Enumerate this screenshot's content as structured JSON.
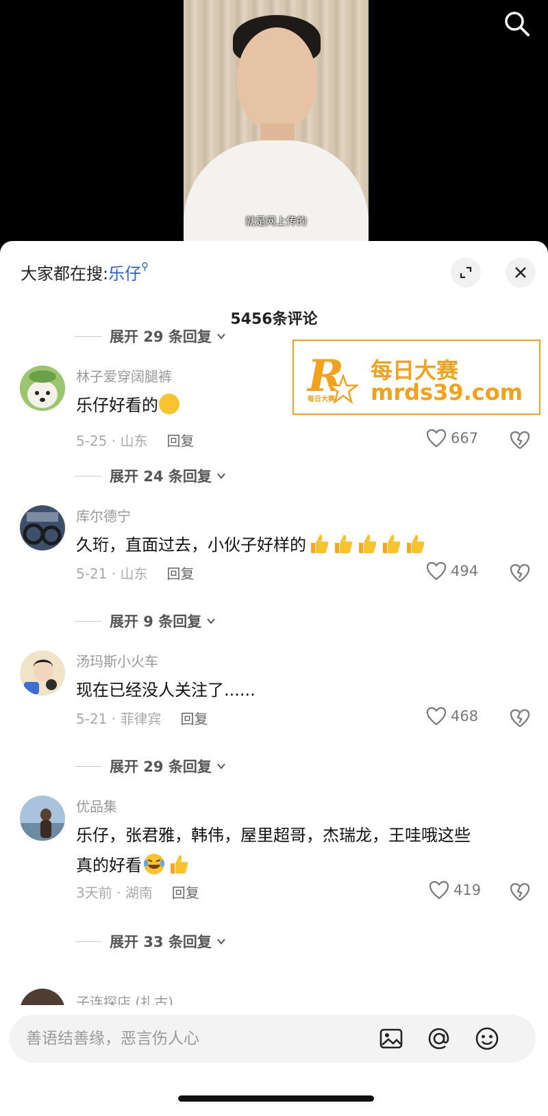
{
  "video": {
    "subtitle": "就是网上传的",
    "search_icon": "search-icon"
  },
  "header": {
    "search_prefix": "大家都在搜:",
    "search_keyword": "乐仔",
    "expand_icon": "expand-icon",
    "close_icon": "close-icon"
  },
  "comment_count": "5456条评论",
  "replies": [
    {
      "label": "展开 29 条回复"
    },
    {
      "label": "展开 24 条回复"
    },
    {
      "label": "展开 9 条回复"
    },
    {
      "label": "展开 29 条回复"
    },
    {
      "label": "展开 33 条回复"
    }
  ],
  "comments": [
    {
      "username": "林子爱穿阔腿裤",
      "text": "乐仔好看的",
      "date_location": "5-25 · 山东",
      "reply_label": "回复",
      "likes": "667"
    },
    {
      "username": "库尔德宁",
      "text": "久珩，直面过去，小伙子好样的",
      "date_location": "5-21 · 山东",
      "reply_label": "回复",
      "likes": "494"
    },
    {
      "username": "汤玛斯小火车",
      "text": "现在已经没人关注了......",
      "date_location": "5-21 · 菲律宾",
      "reply_label": "回复",
      "likes": "468"
    },
    {
      "username": "优品集",
      "text_line1": "乐仔，张君雅，韩伟，屋里超哥，杰瑞龙，王哇哦这些",
      "text_line2": "真的好看",
      "date_location": "3天前 · 湖南",
      "reply_label": "回复",
      "likes": "419"
    }
  ],
  "partial_comment": {
    "username": "子连探店 (扎古)"
  },
  "watermark": {
    "letter": "R",
    "small_text": "每日大赛",
    "title": "每日大赛",
    "url": "mrds39.com"
  },
  "input": {
    "placeholder": "善语结善缘，恶言伤人心",
    "icons": [
      "image-icon",
      "at-icon",
      "emoji-icon"
    ]
  },
  "colors": {
    "keyword": "#2a62c8",
    "watermark": "#f0a21c"
  }
}
